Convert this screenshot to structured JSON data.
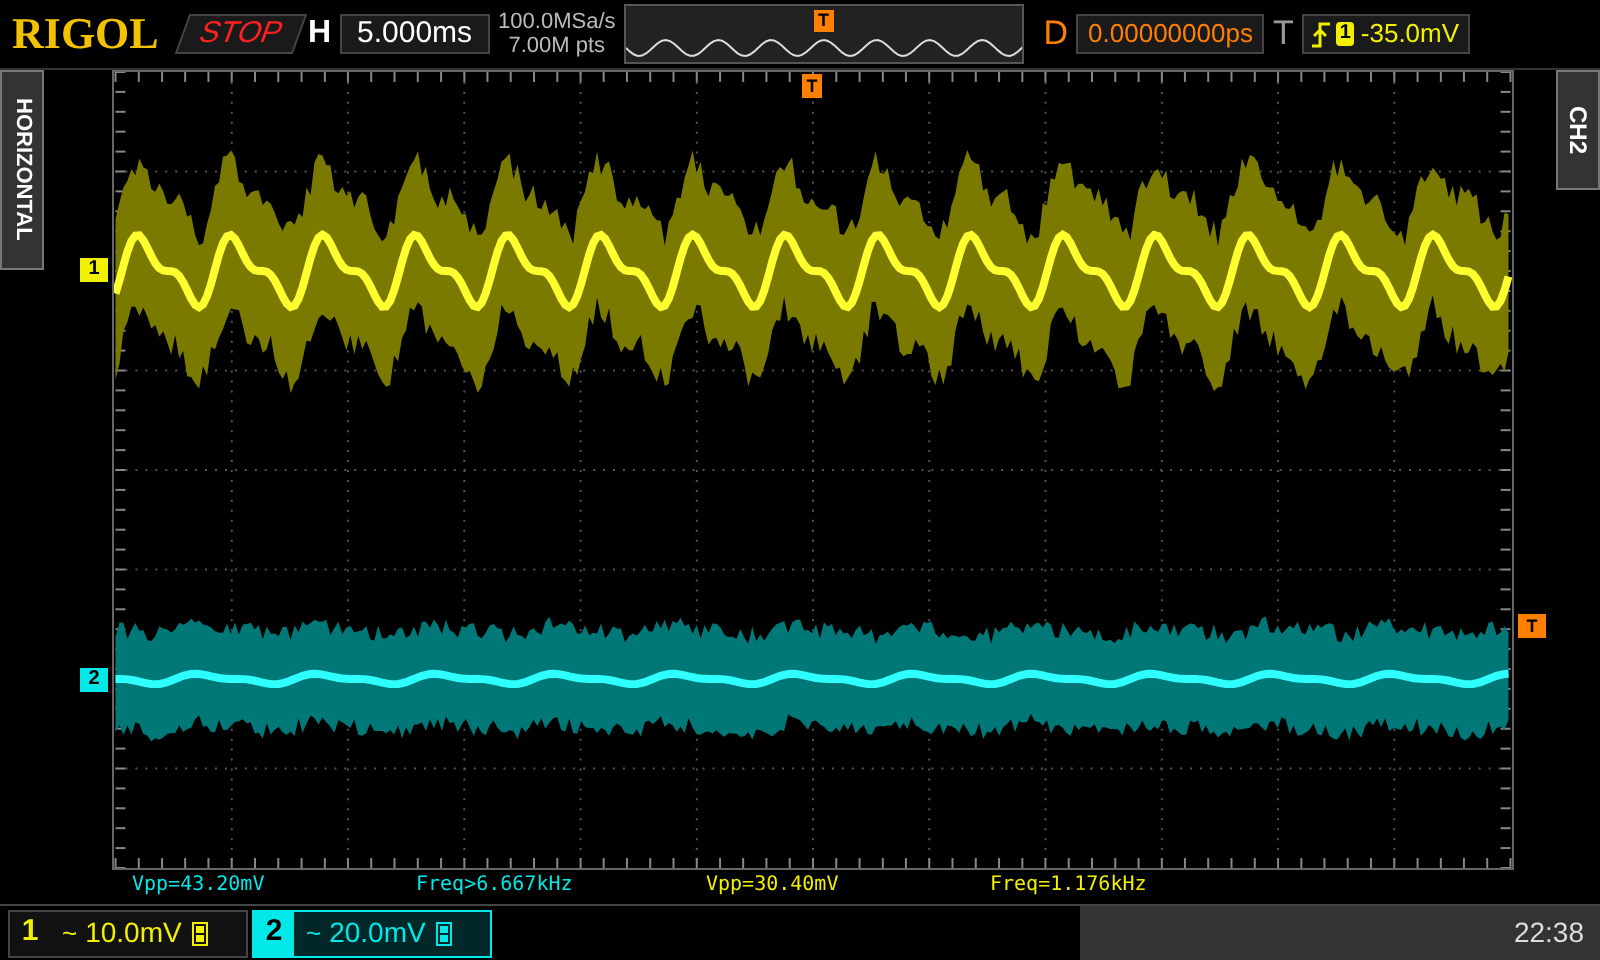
{
  "header": {
    "brand": "RIGOL",
    "run_state": "STOP",
    "timebase_label": "H",
    "timebase": "5.000ms",
    "sample_rate": "100.0MSa/s",
    "memory_depth": "7.00M pts",
    "trigger_position_marker": "T",
    "delay_label": "D",
    "delay": "0.00000000ps",
    "trigger_label": "T",
    "trigger_channel": "1",
    "trigger_level": "-35.0mV"
  },
  "side_tabs": {
    "left": "HORIZONTAL",
    "right": "CH2"
  },
  "grid": {
    "trigger_position_marker": "T",
    "trigger_level_marker": "T",
    "channel_markers": [
      {
        "label": "1",
        "color": "#f0f000"
      },
      {
        "label": "2",
        "color": "#00e8e8"
      }
    ]
  },
  "measurements": [
    {
      "text": "Vpp=43.20mV",
      "color": "#00e8e8"
    },
    {
      "text": "Freq>6.667kHz",
      "color": "#00e8e8"
    },
    {
      "text": "Vpp=30.40mV",
      "color": "#f0f000"
    },
    {
      "text": "Freq=1.176kHz",
      "color": "#f0f000"
    }
  ],
  "channels": [
    {
      "number": "1",
      "coupling": "~",
      "scale": "10.0mV",
      "selected": false,
      "color": "#f0f000"
    },
    {
      "number": "2",
      "coupling": "~",
      "scale": "20.0mV",
      "selected": true,
      "color": "#00e8e8"
    }
  ],
  "clock": "22:38"
}
